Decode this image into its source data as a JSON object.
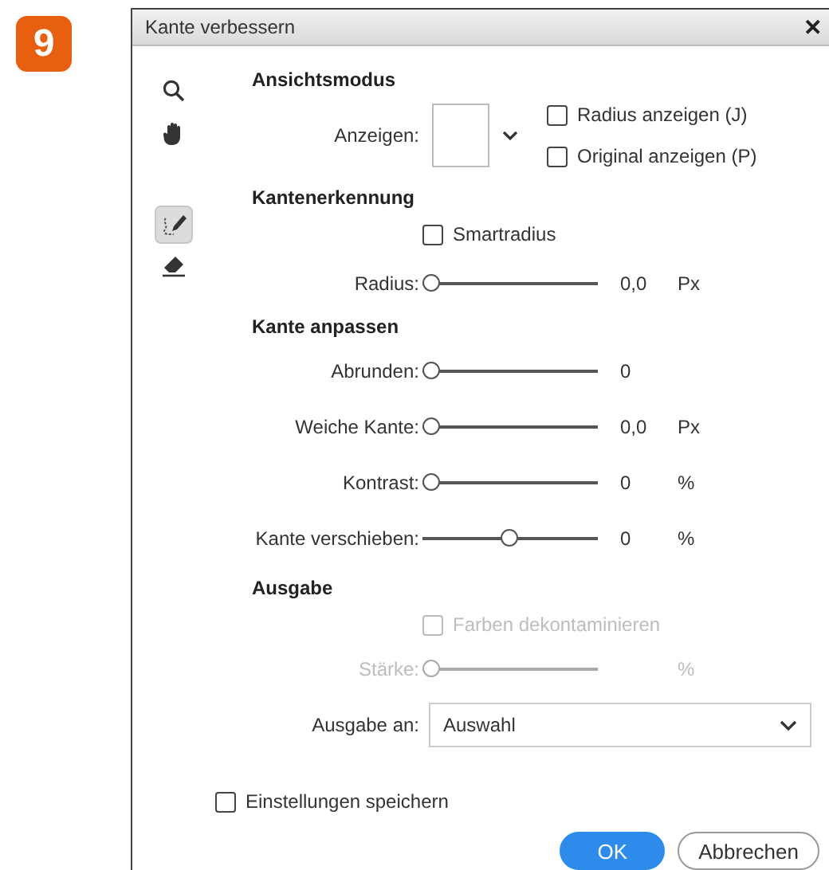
{
  "badge": "9",
  "window": {
    "title": "Kante verbessern",
    "close": "✕"
  },
  "tools": [
    {
      "kind": "zoom",
      "selected": false
    },
    {
      "kind": "hand",
      "selected": false
    },
    {
      "kind": "brush",
      "selected": true
    },
    {
      "kind": "eraser",
      "selected": false
    }
  ],
  "view_mode": {
    "heading": "Ansichtsmodus",
    "label": "Anzeigen:",
    "checkboxes": [
      {
        "label": "Radius anzeigen (J)",
        "checked": false
      },
      {
        "label": "Original anzeigen (P)",
        "checked": false
      }
    ]
  },
  "edge_detection": {
    "heading": "Kantenerkennung",
    "checkbox": {
      "label": "Smartradius",
      "checked": false
    },
    "sliders": [
      {
        "label": "Radius:",
        "level": 0,
        "reading": "0,0",
        "unit": "Px",
        "disabled": false
      }
    ]
  },
  "adjust_edge": {
    "heading": "Kante anpassen",
    "sliders": [
      {
        "label": "Abrunden:",
        "level": 0,
        "reading": "0",
        "disabled": false
      },
      {
        "label": "Weiche Kante:",
        "level": 0,
        "reading": "0,0",
        "unit": "Px",
        "disabled": false
      },
      {
        "label": "Kontrast:",
        "level": 0,
        "reading": "0",
        "unit": "%",
        "disabled": false
      },
      {
        "label": "Kante verschieben:",
        "level": 0.5,
        "reading": "0",
        "unit": "%",
        "disabled": false
      }
    ]
  },
  "output": {
    "heading": "Ausgabe",
    "checkbox": {
      "label": "Farben dekontaminieren",
      "checked": false,
      "disabled": true
    },
    "sliders": [
      {
        "label": "Stärke:",
        "level": 0,
        "unit": "%",
        "disabled": true
      }
    ],
    "select": {
      "label": "Ausgabe an:",
      "value": "Auswahl"
    }
  },
  "save_settings": {
    "label": "Einstellungen speichern",
    "checked": false
  },
  "buttons": [
    {
      "label": "OK",
      "primary": true
    },
    {
      "label": "Abbrechen",
      "primary": false
    }
  ]
}
